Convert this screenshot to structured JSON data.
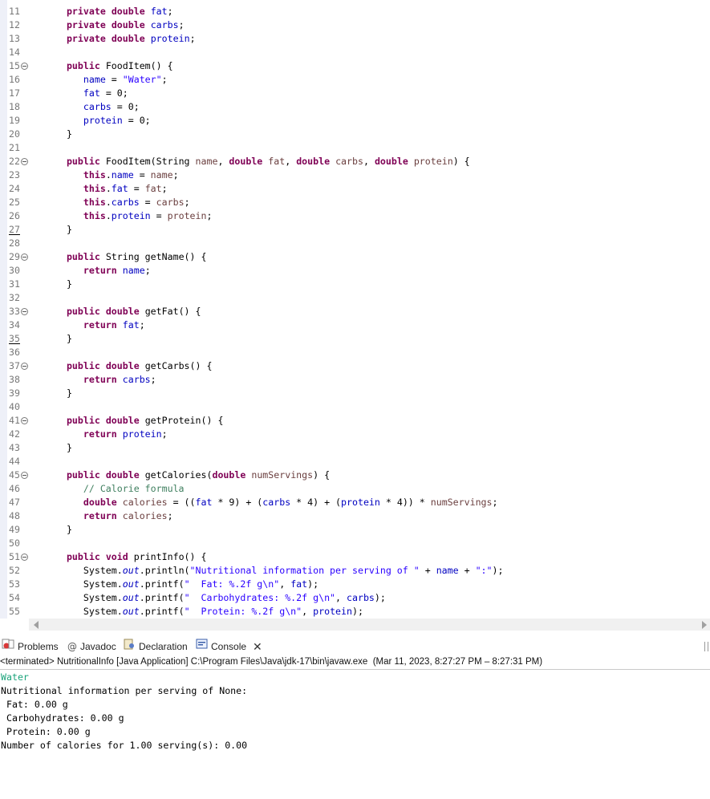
{
  "editor": {
    "lines": [
      {
        "num": "11",
        "fold": false,
        "underline": false,
        "tokens": [
          [
            "ws",
            "   "
          ],
          [
            "kw",
            "private"
          ],
          [
            "t",
            " "
          ],
          [
            "kw",
            "double"
          ],
          [
            "t",
            " "
          ],
          [
            "fld",
            "fat"
          ],
          [
            "t",
            ";"
          ]
        ]
      },
      {
        "num": "12",
        "fold": false,
        "underline": false,
        "tokens": [
          [
            "ws",
            "   "
          ],
          [
            "kw",
            "private"
          ],
          [
            "t",
            " "
          ],
          [
            "kw",
            "double"
          ],
          [
            "t",
            " "
          ],
          [
            "fld",
            "carbs"
          ],
          [
            "t",
            ";"
          ]
        ]
      },
      {
        "num": "13",
        "fold": false,
        "underline": false,
        "tokens": [
          [
            "ws",
            "   "
          ],
          [
            "kw",
            "private"
          ],
          [
            "t",
            " "
          ],
          [
            "kw",
            "double"
          ],
          [
            "t",
            " "
          ],
          [
            "fld",
            "protein"
          ],
          [
            "t",
            ";"
          ]
        ]
      },
      {
        "num": "14",
        "fold": false,
        "underline": false,
        "tokens": []
      },
      {
        "num": "15",
        "fold": true,
        "underline": false,
        "tokens": [
          [
            "ws",
            "   "
          ],
          [
            "kw",
            "public"
          ],
          [
            "t",
            " FoodItem() {"
          ]
        ]
      },
      {
        "num": "16",
        "fold": false,
        "underline": false,
        "tokens": [
          [
            "ws",
            "      "
          ],
          [
            "fld",
            "name"
          ],
          [
            "t",
            " = "
          ],
          [
            "str",
            "\"Water\""
          ],
          [
            "t",
            ";"
          ]
        ]
      },
      {
        "num": "17",
        "fold": false,
        "underline": false,
        "tokens": [
          [
            "ws",
            "      "
          ],
          [
            "fld",
            "fat"
          ],
          [
            "t",
            " = 0;"
          ]
        ]
      },
      {
        "num": "18",
        "fold": false,
        "underline": false,
        "tokens": [
          [
            "ws",
            "      "
          ],
          [
            "fld",
            "carbs"
          ],
          [
            "t",
            " = 0;"
          ]
        ]
      },
      {
        "num": "19",
        "fold": false,
        "underline": false,
        "tokens": [
          [
            "ws",
            "      "
          ],
          [
            "fld",
            "protein"
          ],
          [
            "t",
            " = 0;"
          ]
        ]
      },
      {
        "num": "20",
        "fold": false,
        "underline": false,
        "tokens": [
          [
            "ws",
            "   "
          ],
          [
            "t",
            "}"
          ]
        ]
      },
      {
        "num": "21",
        "fold": false,
        "underline": false,
        "tokens": []
      },
      {
        "num": "22",
        "fold": true,
        "underline": false,
        "tokens": [
          [
            "ws",
            "   "
          ],
          [
            "kw",
            "public"
          ],
          [
            "t",
            " FoodItem(String "
          ],
          [
            "prm",
            "name"
          ],
          [
            "t",
            ", "
          ],
          [
            "kw",
            "double"
          ],
          [
            "t",
            " "
          ],
          [
            "prm",
            "fat"
          ],
          [
            "t",
            ", "
          ],
          [
            "kw",
            "double"
          ],
          [
            "t",
            " "
          ],
          [
            "prm",
            "carbs"
          ],
          [
            "t",
            ", "
          ],
          [
            "kw",
            "double"
          ],
          [
            "t",
            " "
          ],
          [
            "prm",
            "protein"
          ],
          [
            "t",
            ") {"
          ]
        ]
      },
      {
        "num": "23",
        "fold": false,
        "underline": false,
        "tokens": [
          [
            "ws",
            "      "
          ],
          [
            "kw",
            "this"
          ],
          [
            "t",
            "."
          ],
          [
            "fld",
            "name"
          ],
          [
            "t",
            " = "
          ],
          [
            "prm",
            "name"
          ],
          [
            "t",
            ";"
          ]
        ]
      },
      {
        "num": "24",
        "fold": false,
        "underline": false,
        "tokens": [
          [
            "ws",
            "      "
          ],
          [
            "kw",
            "this"
          ],
          [
            "t",
            "."
          ],
          [
            "fld",
            "fat"
          ],
          [
            "t",
            " = "
          ],
          [
            "prm",
            "fat"
          ],
          [
            "t",
            ";"
          ]
        ]
      },
      {
        "num": "25",
        "fold": false,
        "underline": false,
        "tokens": [
          [
            "ws",
            "      "
          ],
          [
            "kw",
            "this"
          ],
          [
            "t",
            "."
          ],
          [
            "fld",
            "carbs"
          ],
          [
            "t",
            " = "
          ],
          [
            "prm",
            "carbs"
          ],
          [
            "t",
            ";"
          ]
        ]
      },
      {
        "num": "26",
        "fold": false,
        "underline": false,
        "tokens": [
          [
            "ws",
            "      "
          ],
          [
            "kw",
            "this"
          ],
          [
            "t",
            "."
          ],
          [
            "fld",
            "protein"
          ],
          [
            "t",
            " = "
          ],
          [
            "prm",
            "protein"
          ],
          [
            "t",
            ";"
          ]
        ]
      },
      {
        "num": "27",
        "fold": false,
        "underline": true,
        "tokens": [
          [
            "ws",
            "   "
          ],
          [
            "t",
            "}"
          ]
        ]
      },
      {
        "num": "28",
        "fold": false,
        "underline": false,
        "tokens": []
      },
      {
        "num": "29",
        "fold": true,
        "underline": false,
        "tokens": [
          [
            "ws",
            "   "
          ],
          [
            "kw",
            "public"
          ],
          [
            "t",
            " String getName() {"
          ]
        ]
      },
      {
        "num": "30",
        "fold": false,
        "underline": false,
        "tokens": [
          [
            "ws",
            "      "
          ],
          [
            "kw",
            "return"
          ],
          [
            "t",
            " "
          ],
          [
            "fld",
            "name"
          ],
          [
            "t",
            ";"
          ]
        ]
      },
      {
        "num": "31",
        "fold": false,
        "underline": false,
        "tokens": [
          [
            "ws",
            "   "
          ],
          [
            "t",
            "}"
          ]
        ]
      },
      {
        "num": "32",
        "fold": false,
        "underline": false,
        "tokens": []
      },
      {
        "num": "33",
        "fold": true,
        "underline": false,
        "tokens": [
          [
            "ws",
            "   "
          ],
          [
            "kw",
            "public"
          ],
          [
            "t",
            " "
          ],
          [
            "kw",
            "double"
          ],
          [
            "t",
            " getFat() {"
          ]
        ]
      },
      {
        "num": "34",
        "fold": false,
        "underline": false,
        "tokens": [
          [
            "ws",
            "      "
          ],
          [
            "kw",
            "return"
          ],
          [
            "t",
            " "
          ],
          [
            "fld",
            "fat"
          ],
          [
            "t",
            ";"
          ]
        ]
      },
      {
        "num": "35",
        "fold": false,
        "underline": true,
        "tokens": [
          [
            "ws",
            "   "
          ],
          [
            "t",
            "}"
          ]
        ]
      },
      {
        "num": "36",
        "fold": false,
        "underline": false,
        "tokens": []
      },
      {
        "num": "37",
        "fold": true,
        "underline": false,
        "tokens": [
          [
            "ws",
            "   "
          ],
          [
            "kw",
            "public"
          ],
          [
            "t",
            " "
          ],
          [
            "kw",
            "double"
          ],
          [
            "t",
            " getCarbs() {"
          ]
        ]
      },
      {
        "num": "38",
        "fold": false,
        "underline": false,
        "tokens": [
          [
            "ws",
            "      "
          ],
          [
            "kw",
            "return"
          ],
          [
            "t",
            " "
          ],
          [
            "fld",
            "carbs"
          ],
          [
            "t",
            ";"
          ]
        ]
      },
      {
        "num": "39",
        "fold": false,
        "underline": false,
        "tokens": [
          [
            "ws",
            "   "
          ],
          [
            "t",
            "}"
          ]
        ]
      },
      {
        "num": "40",
        "fold": false,
        "underline": false,
        "tokens": []
      },
      {
        "num": "41",
        "fold": true,
        "underline": false,
        "tokens": [
          [
            "ws",
            "   "
          ],
          [
            "kw",
            "public"
          ],
          [
            "t",
            " "
          ],
          [
            "kw",
            "double"
          ],
          [
            "t",
            " getProtein() {"
          ]
        ]
      },
      {
        "num": "42",
        "fold": false,
        "underline": false,
        "tokens": [
          [
            "ws",
            "      "
          ],
          [
            "kw",
            "return"
          ],
          [
            "t",
            " "
          ],
          [
            "fld",
            "protein"
          ],
          [
            "t",
            ";"
          ]
        ]
      },
      {
        "num": "43",
        "fold": false,
        "underline": false,
        "tokens": [
          [
            "ws",
            "   "
          ],
          [
            "t",
            "}"
          ]
        ]
      },
      {
        "num": "44",
        "fold": false,
        "underline": false,
        "tokens": []
      },
      {
        "num": "45",
        "fold": true,
        "underline": false,
        "tokens": [
          [
            "ws",
            "   "
          ],
          [
            "kw",
            "public"
          ],
          [
            "t",
            " "
          ],
          [
            "kw",
            "double"
          ],
          [
            "t",
            " getCalories("
          ],
          [
            "kw",
            "double"
          ],
          [
            "t",
            " "
          ],
          [
            "prm",
            "numServings"
          ],
          [
            "t",
            ") {"
          ]
        ]
      },
      {
        "num": "46",
        "fold": false,
        "underline": false,
        "tokens": [
          [
            "ws",
            "      "
          ],
          [
            "cmt",
            "// Calorie formula"
          ]
        ]
      },
      {
        "num": "47",
        "fold": false,
        "underline": false,
        "tokens": [
          [
            "ws",
            "      "
          ],
          [
            "kw",
            "double"
          ],
          [
            "t",
            " "
          ],
          [
            "prm",
            "calories"
          ],
          [
            "t",
            " = (("
          ],
          [
            "fld",
            "fat"
          ],
          [
            "t",
            " * 9) + ("
          ],
          [
            "fld",
            "carbs"
          ],
          [
            "t",
            " * 4) + ("
          ],
          [
            "fld",
            "protein"
          ],
          [
            "t",
            " * 4)) * "
          ],
          [
            "prm",
            "numServings"
          ],
          [
            "t",
            ";"
          ]
        ]
      },
      {
        "num": "48",
        "fold": false,
        "underline": false,
        "tokens": [
          [
            "ws",
            "      "
          ],
          [
            "kw",
            "return"
          ],
          [
            "t",
            " "
          ],
          [
            "prm",
            "calories"
          ],
          [
            "t",
            ";"
          ]
        ]
      },
      {
        "num": "49",
        "fold": false,
        "underline": false,
        "tokens": [
          [
            "ws",
            "   "
          ],
          [
            "t",
            "}"
          ]
        ]
      },
      {
        "num": "50",
        "fold": false,
        "underline": false,
        "tokens": []
      },
      {
        "num": "51",
        "fold": true,
        "underline": false,
        "tokens": [
          [
            "ws",
            "   "
          ],
          [
            "kw",
            "public"
          ],
          [
            "t",
            " "
          ],
          [
            "kw",
            "void"
          ],
          [
            "t",
            " printInfo() {"
          ]
        ]
      },
      {
        "num": "52",
        "fold": false,
        "underline": false,
        "tokens": [
          [
            "ws",
            "      "
          ],
          [
            "t",
            "System."
          ],
          [
            "stat",
            "out"
          ],
          [
            "t",
            ".println("
          ],
          [
            "str",
            "\"Nutritional information per serving of \""
          ],
          [
            "t",
            " + "
          ],
          [
            "fld",
            "name"
          ],
          [
            "t",
            " + "
          ],
          [
            "str",
            "\":\""
          ],
          [
            "t",
            ");"
          ]
        ]
      },
      {
        "num": "53",
        "fold": false,
        "underline": false,
        "tokens": [
          [
            "ws",
            "      "
          ],
          [
            "t",
            "System."
          ],
          [
            "stat",
            "out"
          ],
          [
            "t",
            ".printf("
          ],
          [
            "str",
            "\"  Fat: %.2f g\\n\""
          ],
          [
            "t",
            ", "
          ],
          [
            "fld",
            "fat"
          ],
          [
            "t",
            ");"
          ]
        ]
      },
      {
        "num": "54",
        "fold": false,
        "underline": false,
        "tokens": [
          [
            "ws",
            "      "
          ],
          [
            "t",
            "System."
          ],
          [
            "stat",
            "out"
          ],
          [
            "t",
            ".printf("
          ],
          [
            "str",
            "\"  Carbohydrates: %.2f g\\n\""
          ],
          [
            "t",
            ", "
          ],
          [
            "fld",
            "carbs"
          ],
          [
            "t",
            ");"
          ]
        ]
      },
      {
        "num": "55",
        "fold": false,
        "underline": false,
        "tokens": [
          [
            "ws",
            "      "
          ],
          [
            "t",
            "System."
          ],
          [
            "stat",
            "out"
          ],
          [
            "t",
            ".printf("
          ],
          [
            "str",
            "\"  Protein: %.2f g\\n\""
          ],
          [
            "t",
            ", "
          ],
          [
            "fld",
            "protein"
          ],
          [
            "t",
            ");"
          ]
        ]
      }
    ]
  },
  "views": {
    "tabs": [
      {
        "name": "tab-problems",
        "label": "Problems",
        "icon": "problems-icon",
        "active": false
      },
      {
        "name": "tab-javadoc",
        "label": "Javadoc",
        "icon": "javadoc-icon",
        "active": false
      },
      {
        "name": "tab-declaration",
        "label": "Declaration",
        "icon": "declaration-icon",
        "active": false
      },
      {
        "name": "tab-console",
        "label": "Console",
        "icon": "console-icon",
        "active": true
      }
    ],
    "close_glyph": "✕"
  },
  "console": {
    "status": "<terminated> NutritionalInfo [Java Application] C:\\Program Files\\Java\\jdk-17\\bin\\javaw.exe  (Mar 11, 2023, 8:27:27 PM – 8:27:31 PM)",
    "output": [
      {
        "text": "Water",
        "input": true
      },
      {
        "text": "Nutritional information per serving of None:",
        "input": false
      },
      {
        "text": " Fat: 0.00 g",
        "input": false
      },
      {
        "text": " Carbohydrates: 0.00 g",
        "input": false
      },
      {
        "text": " Protein: 0.00 g",
        "input": false
      },
      {
        "text": "Number of calories for 1.00 serving(s): 0.00",
        "input": false
      }
    ]
  },
  "colors": {
    "keyword": "#7f0055",
    "field": "#0000c0",
    "string": "#2a00ff",
    "comment": "#3f7f5f",
    "param": "#6a3e3e",
    "console_input": "#1aa37a"
  }
}
